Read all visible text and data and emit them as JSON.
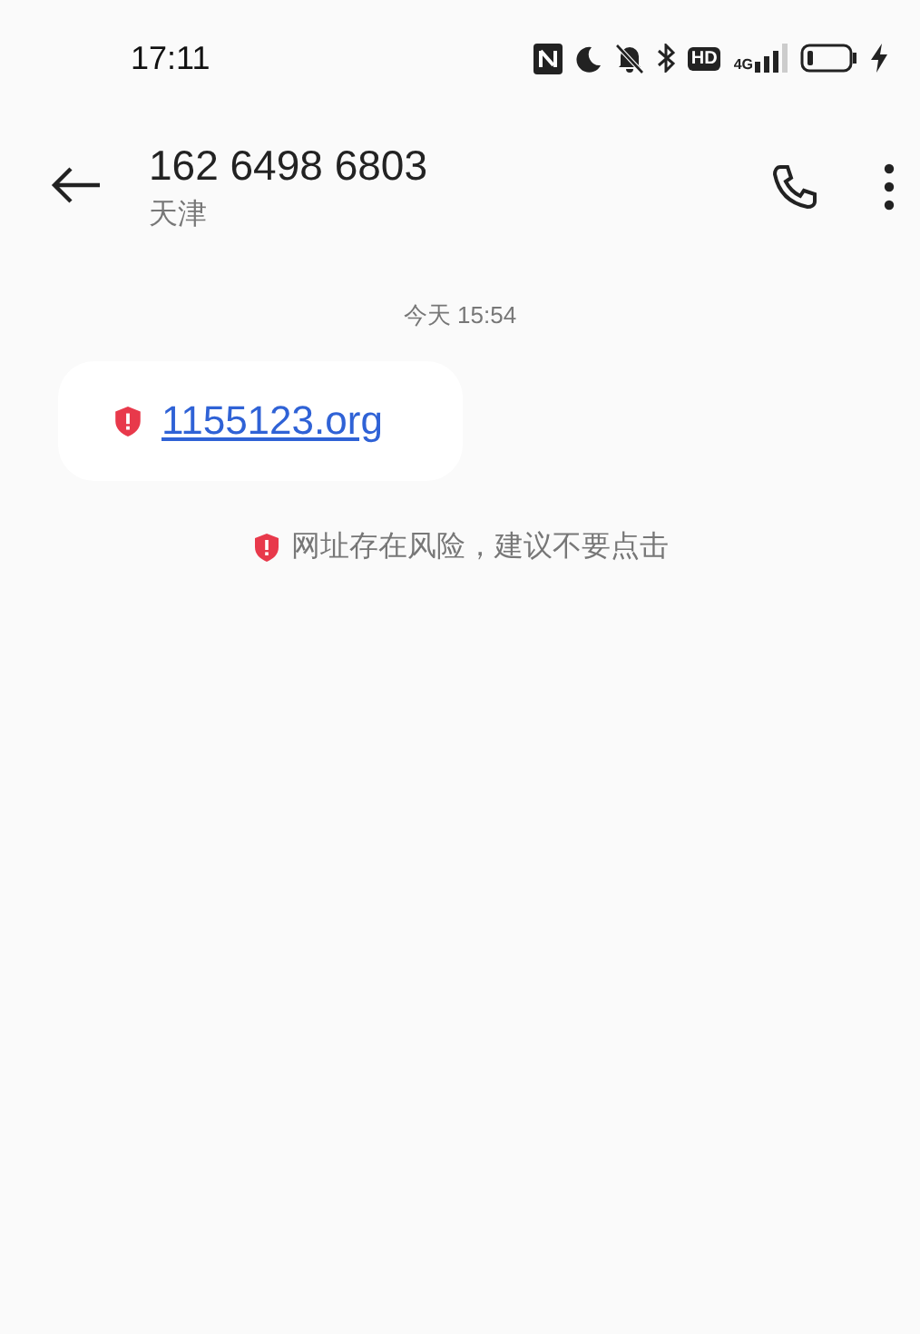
{
  "status_bar": {
    "time": "17:11",
    "hd_badge": "HD",
    "network": "4G"
  },
  "header": {
    "title": "162 6498 6803",
    "subtitle": "天津"
  },
  "messages": [
    {
      "kind": "timestamp",
      "text": "今天 15:54"
    },
    {
      "kind": "link_bubble",
      "text": "1155123.org",
      "risky": true
    },
    {
      "kind": "warning",
      "text": "网址存在风险，建议不要点击"
    }
  ]
}
